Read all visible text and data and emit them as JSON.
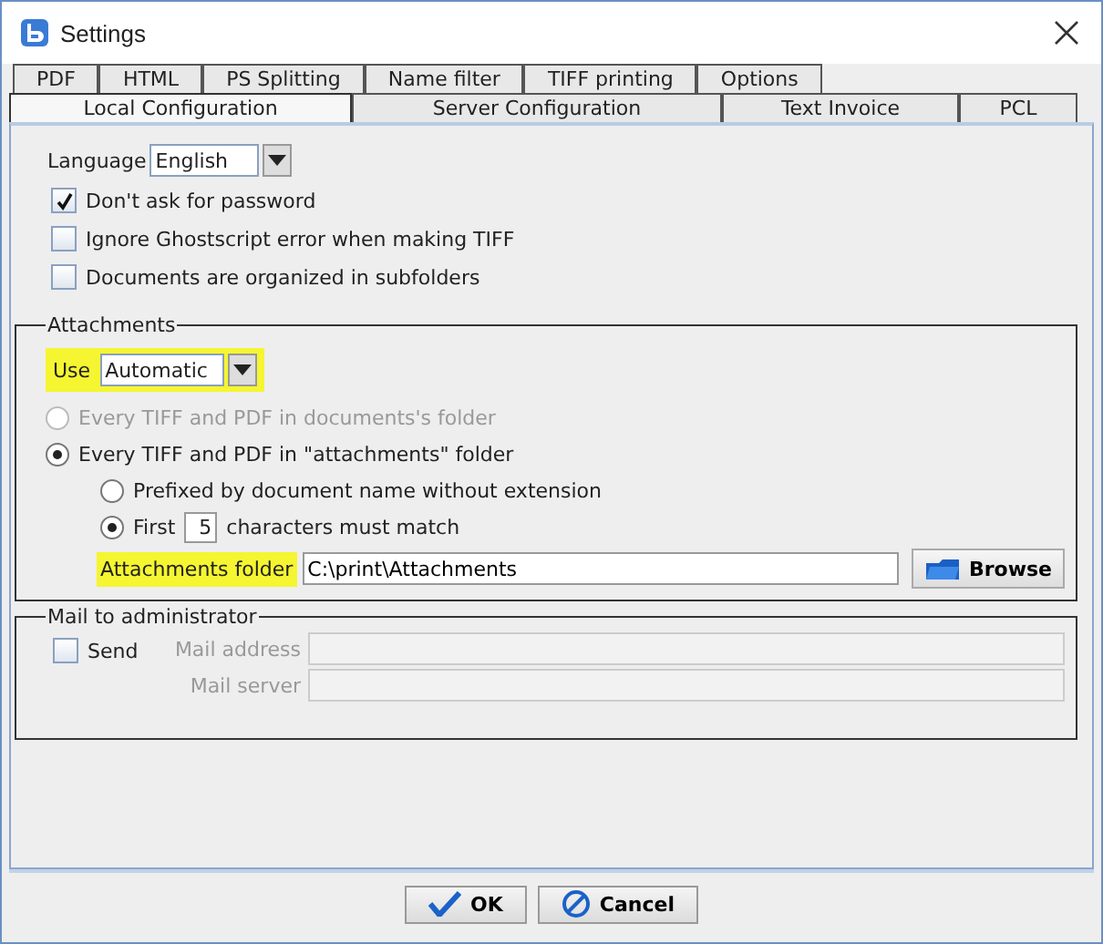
{
  "window": {
    "title": "Settings"
  },
  "tab_rows": [
    [
      {
        "label": "PDF",
        "selected": false
      },
      {
        "label": "HTML",
        "selected": false
      },
      {
        "label": "PS Splitting",
        "selected": false
      },
      {
        "label": "Name filter",
        "selected": false
      },
      {
        "label": "TIFF printing",
        "selected": false
      },
      {
        "label": "Options",
        "selected": false
      }
    ],
    [
      {
        "label": "Local Configuration",
        "selected": true
      },
      {
        "label": "Server Configuration",
        "selected": false
      },
      {
        "label": "Text Invoice",
        "selected": false
      },
      {
        "label": "PCL",
        "selected": false
      }
    ]
  ],
  "language": {
    "label": "Language",
    "value": "English"
  },
  "options": [
    {
      "label": "Don't ask for password",
      "checked": true
    },
    {
      "label": "Ignore Ghostscript error when making TIFF",
      "checked": false
    },
    {
      "label": "Documents are organized in subfolders",
      "checked": false
    }
  ],
  "attachments": {
    "title": "Attachments",
    "use": {
      "label": "Use",
      "value": "Automatic",
      "highlighted": true
    },
    "sources": [
      {
        "label": "Every TIFF and PDF in documents's folder",
        "selected": false,
        "disabled": true
      },
      {
        "label": "Every TIFF and PDF in \"attachments\" folder",
        "selected": true,
        "disabled": false
      }
    ],
    "match_modes": [
      {
        "kind": "prefix",
        "label": "Prefixed by document name without extension",
        "selected": false
      },
      {
        "kind": "first",
        "label": "First",
        "value": "5",
        "suffix": "characters must match",
        "selected": true
      }
    ],
    "folder": {
      "label": "Attachments folder",
      "value": "C:\\print\\Attachments",
      "highlighted": true
    },
    "browse": "Browse"
  },
  "mail": {
    "title": "Mail to administrator",
    "send": {
      "label": "Send",
      "checked": false
    },
    "fields": [
      {
        "label": "Mail address",
        "disabled": true
      },
      {
        "label": "Mail server",
        "disabled": true
      }
    ]
  },
  "buttons": [
    {
      "kind": "ok",
      "label": "OK"
    },
    {
      "kind": "cancel",
      "label": "Cancel"
    }
  ]
}
